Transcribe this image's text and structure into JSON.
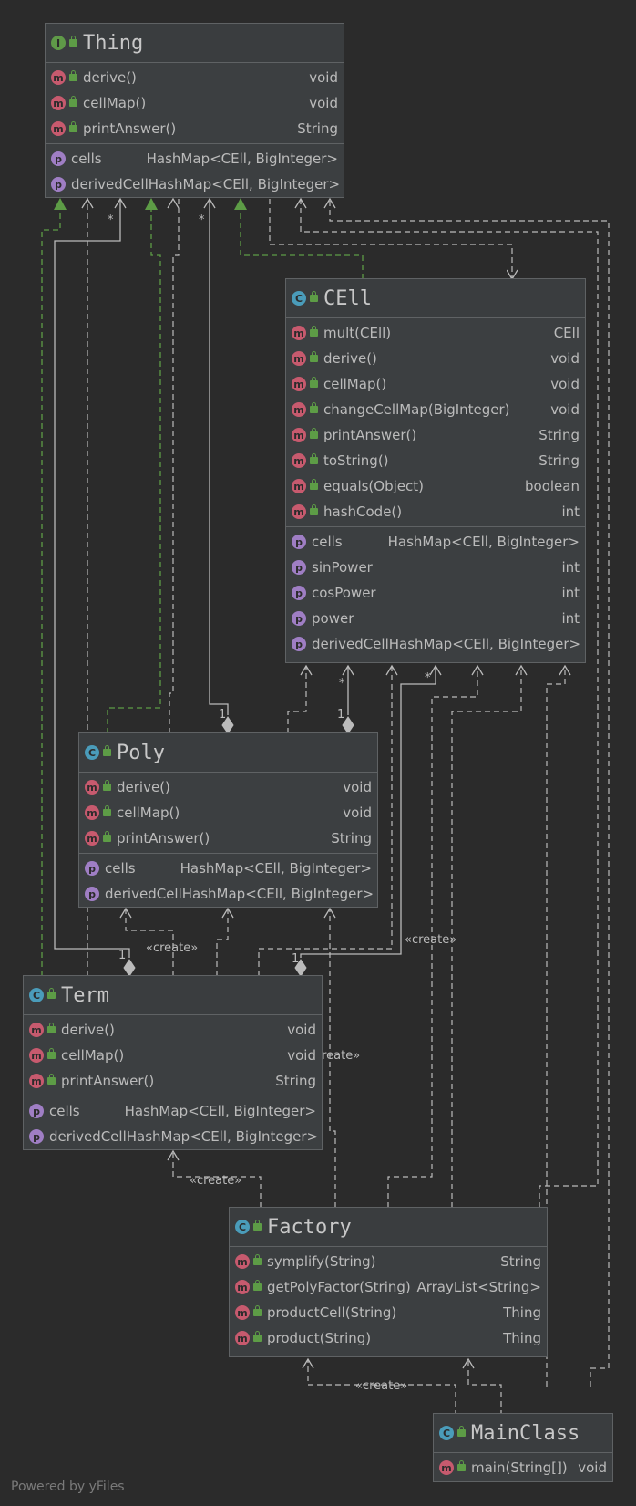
{
  "classes": {
    "thing": {
      "title": "Thing",
      "kind": "I",
      "methods": [
        {
          "name": "derive()",
          "type": "void"
        },
        {
          "name": "cellMap()",
          "type": "void"
        },
        {
          "name": "printAnswer()",
          "type": "String"
        }
      ],
      "fields": [
        {
          "name": "cells",
          "type": "HashMap<CEll, BigInteger>"
        },
        {
          "name": "derivedCell",
          "type": "HashMap<CEll, BigInteger>"
        }
      ]
    },
    "cell": {
      "title": "CEll",
      "kind": "C",
      "methods": [
        {
          "name": "mult(CEll)",
          "type": "CEll"
        },
        {
          "name": "derive()",
          "type": "void"
        },
        {
          "name": "cellMap()",
          "type": "void"
        },
        {
          "name": "changeCellMap(BigInteger)",
          "type": "void"
        },
        {
          "name": "printAnswer()",
          "type": "String"
        },
        {
          "name": "toString()",
          "type": "String"
        },
        {
          "name": "equals(Object)",
          "type": "boolean"
        },
        {
          "name": "hashCode()",
          "type": "int"
        }
      ],
      "fields": [
        {
          "name": "cells",
          "type": "HashMap<CEll, BigInteger>"
        },
        {
          "name": "sinPower",
          "type": "int"
        },
        {
          "name": "cosPower",
          "type": "int"
        },
        {
          "name": "power",
          "type": "int"
        },
        {
          "name": "derivedCell",
          "type": "HashMap<CEll, BigInteger>"
        }
      ]
    },
    "poly": {
      "title": "Poly",
      "kind": "C",
      "methods": [
        {
          "name": "derive()",
          "type": "void"
        },
        {
          "name": "cellMap()",
          "type": "void"
        },
        {
          "name": "printAnswer()",
          "type": "String"
        }
      ],
      "fields": [
        {
          "name": "cells",
          "type": "HashMap<CEll, BigInteger>"
        },
        {
          "name": "derivedCell",
          "type": "HashMap<CEll, BigInteger>"
        }
      ]
    },
    "term": {
      "title": "Term",
      "kind": "C",
      "methods": [
        {
          "name": "derive()",
          "type": "void"
        },
        {
          "name": "cellMap()",
          "type": "void"
        },
        {
          "name": "printAnswer()",
          "type": "String"
        }
      ],
      "fields": [
        {
          "name": "cells",
          "type": "HashMap<CEll, BigInteger>"
        },
        {
          "name": "derivedCell",
          "type": "HashMap<CEll, BigInteger>"
        }
      ]
    },
    "factory": {
      "title": "Factory",
      "kind": "C",
      "methods": [
        {
          "name": "symplify(String)",
          "type": "String"
        },
        {
          "name": "getPolyFactor(String)",
          "type": "ArrayList<String>"
        },
        {
          "name": "productCell(String)",
          "type": "Thing"
        },
        {
          "name": "product(String)",
          "type": "Thing"
        }
      ],
      "fields": []
    },
    "mainclass": {
      "title": "MainClass",
      "kind": "C",
      "methods": [
        {
          "name": "main(String[])",
          "type": "void"
        }
      ],
      "fields": []
    }
  },
  "badges": {
    "method": "m",
    "field": "p"
  },
  "labels": {
    "create": "«create»",
    "many": "*",
    "one": "1"
  },
  "colors": {
    "background": "#2b2b2b",
    "box": "#3c3f41",
    "edge": "#bbbbbb",
    "realization": "#5d9c46",
    "method_badge": "#c75a6e",
    "field_badge": "#9f7ec4",
    "class_badge": "#4a9cba",
    "interface_badge": "#5f9a48"
  },
  "footer": "Powered by yFiles"
}
